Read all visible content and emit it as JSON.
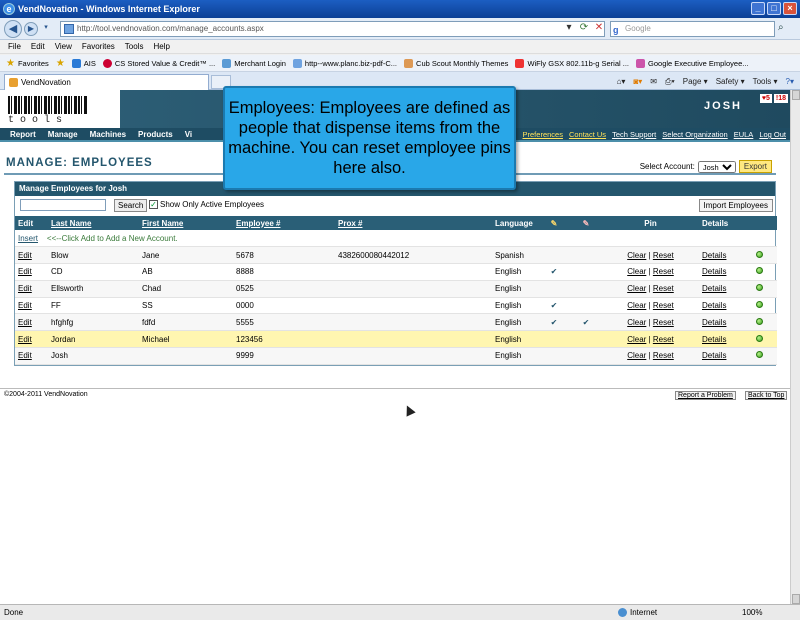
{
  "window": {
    "title": "VendNovation - Windows Internet Explorer"
  },
  "browser": {
    "url": "http://tool.vendnovation.com/manage_accounts.aspx",
    "search_placeholder": "Google",
    "menu": [
      "File",
      "Edit",
      "View",
      "Favorites",
      "Tools",
      "Help"
    ],
    "favorites_label": "Favorites",
    "favorites": [
      "AIS",
      "CS Stored Value & Credit™ ...",
      "Merchant Login",
      "http--www.planc.biz-pdf-C...",
      "Cub Scout Monthly Themes",
      "WiFly GSX 802.11b-g Serial ...",
      "Google Executive Employee..."
    ],
    "tab_title": "VendNovation",
    "commands": [
      "Page ▾",
      "Safety ▾",
      "Tools ▾"
    ],
    "status_text": "Done",
    "zone": "Internet",
    "zoom": "100%"
  },
  "site": {
    "logo_text": "tools",
    "user": "JOSH",
    "alerts": [
      "♥5",
      "!18"
    ],
    "nav": [
      "Report",
      "Manage",
      "Machines",
      "Products",
      "Vi"
    ],
    "util_links": [
      "Preferences",
      "Contact Us",
      "Tech Support",
      "Select Organization",
      "EULA",
      "Log Out"
    ]
  },
  "page": {
    "title": "MANAGE: EMPLOYEES",
    "select_account_label": "Select Account:",
    "selected_account": "Josh",
    "export_label": "Export",
    "panel_title": "Manage Employees for Josh",
    "search_label": "Search",
    "active_only_label": "Show Only Active Employees",
    "import_label": "Import Employees",
    "columns": [
      "Edit",
      "Last Name",
      "First Name",
      "Employee #",
      "Prox #",
      "Language",
      "",
      "",
      "Pin",
      "Details",
      ""
    ],
    "insert_label": "Insert",
    "insert_hint": "<<--Click Add to Add a New Account.",
    "edit_label": "Edit",
    "clear_label": "Clear",
    "reset_label": "Reset",
    "details_label": "Details",
    "rows": [
      {
        "last": "Blow",
        "first": "Jane",
        "emp": "5678",
        "prox": "4382600080442012",
        "lang": "Spanish",
        "c1": "",
        "c2": ""
      },
      {
        "last": "CD",
        "first": "AB",
        "emp": "8888",
        "prox": "",
        "lang": "English",
        "c1": "✔",
        "c2": ""
      },
      {
        "last": "Ellsworth",
        "first": "Chad",
        "emp": "0525",
        "prox": "",
        "lang": "English",
        "c1": "",
        "c2": ""
      },
      {
        "last": "FF",
        "first": "SS",
        "emp": "0000",
        "prox": "",
        "lang": "English",
        "c1": "✔",
        "c2": ""
      },
      {
        "last": "hfghfg",
        "first": "fdfd",
        "emp": "5555",
        "prox": "",
        "lang": "English",
        "c1": "✔",
        "c2": "✔"
      },
      {
        "last": "Jordan",
        "first": "Michael",
        "emp": "123456",
        "prox": "",
        "lang": "English",
        "c1": "",
        "c2": ""
      },
      {
        "last": "Josh",
        "first": "",
        "emp": "9999",
        "prox": "",
        "lang": "English",
        "c1": "",
        "c2": ""
      }
    ],
    "footer_copy": "©2004-2011 VendNovation",
    "report_problem": "Report a Problem",
    "back_to_top": "Back to Top"
  },
  "callout": {
    "text": "Employees: Employees are defined as people that  dispense items from the machine. You can reset employee pins here also."
  },
  "colors": {
    "header": "#24566d",
    "callout": "#29a7e8",
    "highlight_row": "#fff6b0",
    "export": "#ffe880"
  }
}
